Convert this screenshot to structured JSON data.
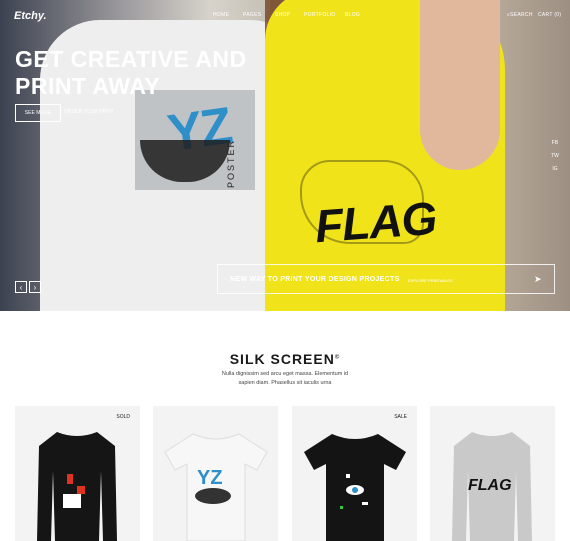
{
  "header": {
    "logo": "Etchy.",
    "nav": [
      "HOME",
      "PAGES",
      "SHOP",
      "PORTFOLIO",
      "BLOG"
    ],
    "search_label": "SEARCH",
    "cart_label": "CART (0)"
  },
  "hero": {
    "title_line1": "GET CREATIVE AND",
    "title_line2": "PRINT AWAY",
    "see_more": "SEE MORE",
    "order_link": "ORDER YOUR PRINT",
    "print_left_text": "YZ",
    "print_left_label": "POSTER",
    "print_right_text": "FLAG",
    "social": [
      "FB",
      "TW",
      "IG"
    ],
    "promo_title": "NEW WAY TO PRINT YOUR DESIGN PROJECTS",
    "promo_sub": "EXPLORE PRINTABLES"
  },
  "section": {
    "title": "SILK SCREEN",
    "title_mark": "©",
    "desc": "Nulla dignissim sed arcu eget massa. Elementum id sapien diam. Phasellus sit iaculis urna"
  },
  "products": [
    {
      "badge": "SOLD",
      "color": "#151515"
    },
    {
      "badge": "",
      "color": "#f5f5f5"
    },
    {
      "badge": "SALE",
      "color": "#141414"
    },
    {
      "badge": "",
      "color": "#c9c9c9"
    }
  ],
  "icons": {
    "prev": "chevron-left-icon",
    "next": "chevron-right-icon",
    "search": "search-icon",
    "promo": "paper-plane-icon"
  }
}
